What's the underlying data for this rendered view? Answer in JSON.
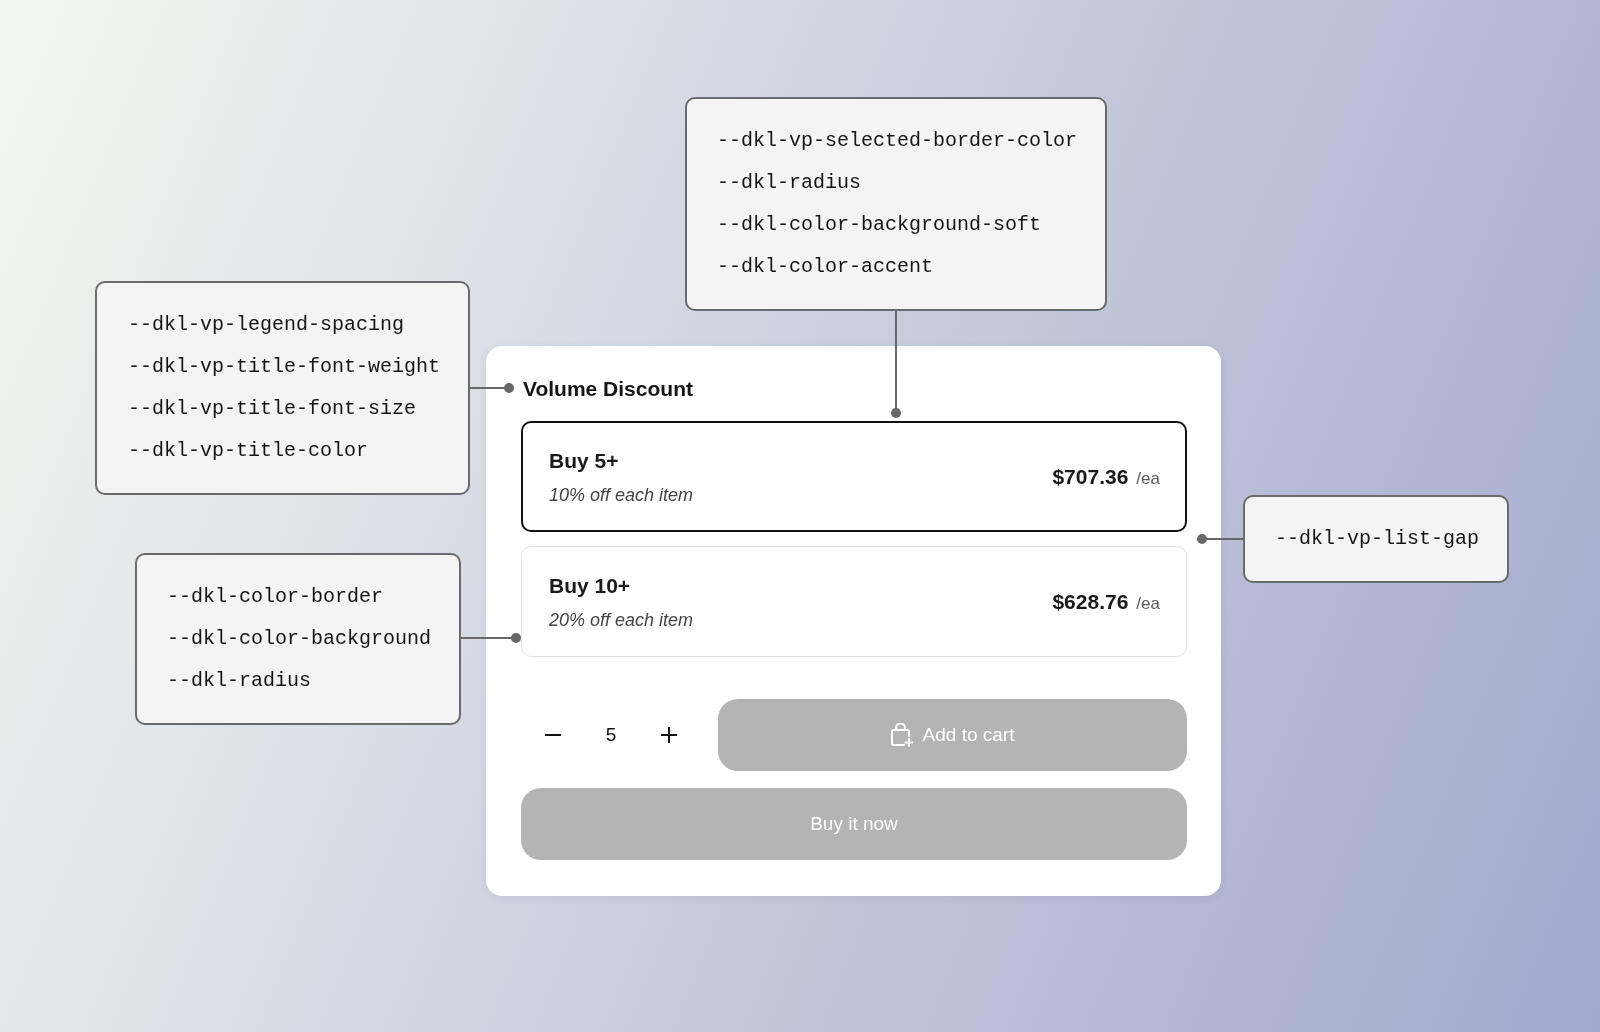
{
  "callouts": [
    {
      "lines": [
        "--dkl-vp-selected-border-color",
        "--dkl-radius",
        "--dkl-color-background-soft",
        "--dkl-color-accent"
      ]
    },
    {
      "lines": [
        "--dkl-vp-legend-spacing",
        "--dkl-vp-title-font-weight",
        "--dkl-vp-title-font-size",
        "--dkl-vp-title-color"
      ]
    },
    {
      "lines": [
        "--dkl-vp-list-gap"
      ]
    },
    {
      "lines": [
        "--dkl-color-border",
        "--dkl-color-background",
        "--dkl-radius"
      ]
    }
  ],
  "widget": {
    "title": "Volume Discount",
    "tiers": [
      {
        "label": "Buy 5+",
        "description": "10% off each item",
        "price": "$707.36",
        "unit": "/ea",
        "selected": true
      },
      {
        "label": "Buy 10+",
        "description": "20% off each item",
        "price": "$628.76",
        "unit": "/ea",
        "selected": false
      }
    ],
    "quantity": {
      "value": "5"
    },
    "add_to_cart": {
      "label": "Add to cart",
      "disabled": true
    },
    "buy_now": {
      "label": "Buy it now",
      "disabled": true
    }
  }
}
